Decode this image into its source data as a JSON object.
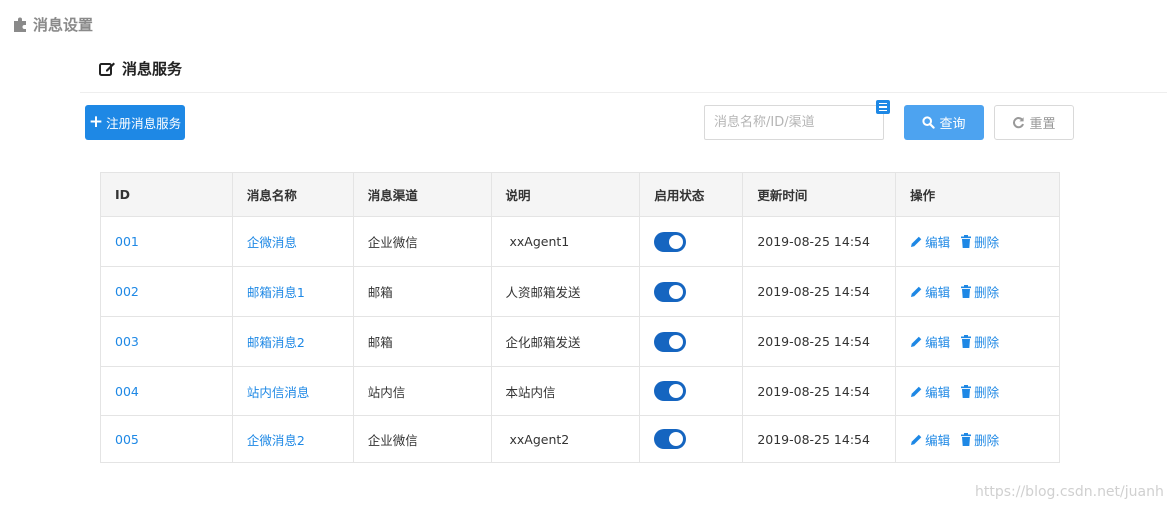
{
  "page": {
    "title": "消息设置"
  },
  "section": {
    "title": "消息服务"
  },
  "toolbar": {
    "add_label": "注册消息服务",
    "search_placeholder": "消息名称/ID/渠道",
    "search_value": "",
    "query_label": "查询",
    "reset_label": "重置"
  },
  "table": {
    "headers": [
      "ID",
      "消息名称",
      "消息渠道",
      "说明",
      "启用状态",
      "更新时间",
      "操作"
    ],
    "rows": [
      {
        "id": "001",
        "name": "企微消息",
        "channel": "企业微信",
        "desc": " xxAgent1",
        "enabled": true,
        "updated": "2019-08-25 14:54"
      },
      {
        "id": "002",
        "name": "邮箱消息1",
        "channel": "邮箱",
        "desc": "人资邮箱发送",
        "enabled": true,
        "updated": "2019-08-25 14:54"
      },
      {
        "id": "003",
        "name": "邮箱消息2",
        "channel": "邮箱",
        "desc": "企化邮箱发送",
        "enabled": true,
        "updated": "2019-08-25 14:54"
      },
      {
        "id": "004",
        "name": "站内信消息",
        "channel": "站内信",
        "desc": "本站内信",
        "enabled": true,
        "updated": "2019-08-25 14:54"
      },
      {
        "id": "005",
        "name": "企微消息2",
        "channel": "企业微信",
        "desc": " xxAgent2",
        "enabled": true,
        "updated": "2019-08-25 14:54"
      }
    ],
    "edit_label": "编辑",
    "delete_label": "删除"
  },
  "watermark": "https://blog.csdn.net/juanh",
  "colors": {
    "primary": "#1e88e5",
    "query": "#4da3f0",
    "toggle_on": "#1565c0"
  }
}
